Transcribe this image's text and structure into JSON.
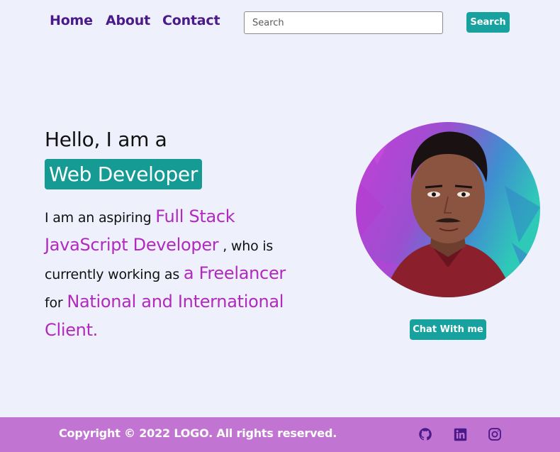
{
  "nav": {
    "links": [
      "Home",
      "About",
      "Contact"
    ],
    "search_placeholder": "Search",
    "search_button": "Search"
  },
  "hero": {
    "greeting": "Hello, I am a",
    "role": "Web Developer",
    "bio": {
      "t1": "I am an aspiring ",
      "h1": "Full Stack JavaScript Developer",
      "t2": " , who is currently working as ",
      "h2": "a Freelancer",
      "t3": " for ",
      "h3": "National and International Client."
    },
    "chat_button": "Chat With me"
  },
  "footer": {
    "copyright": "Copyright © 2022 LOGO. All rights reserved.",
    "social_icons": [
      "github-icon",
      "linkedin-icon",
      "instagram-icon"
    ]
  },
  "colors": {
    "background": "#eef0fc",
    "nav_link": "#4b1a8a",
    "accent": "#17a2a0",
    "highlight": "#b02abf",
    "footer": "#c274d3"
  }
}
